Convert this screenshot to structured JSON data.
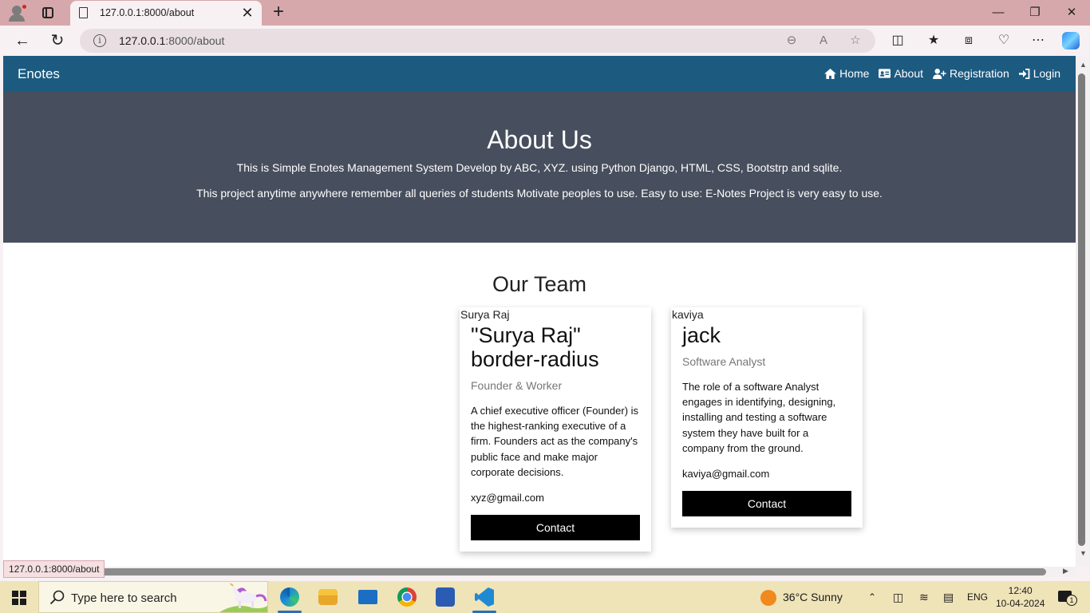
{
  "browser": {
    "tab_title": "127.0.0.1:8000/about",
    "address_host": "127.0.0.1",
    "address_path": ":8000/about",
    "status_url": "127.0.0.1:8000/about",
    "window_controls": {
      "minimize": "—",
      "restore": "❐",
      "close": "✕"
    },
    "icons": [
      "profile-icon",
      "tab-actions-icon",
      "page-icon",
      "close-tab-icon",
      "new-tab-icon",
      "back-icon",
      "refresh-icon",
      "site-info-icon",
      "zoom-out-icon",
      "read-aloud-icon",
      "favorite-star-icon",
      "split-screen-icon",
      "favorites-icon",
      "collections-icon",
      "browser-essentials-icon",
      "more-icon",
      "copilot-icon"
    ]
  },
  "navbar": {
    "brand": "Enotes",
    "links": [
      {
        "label": "Home",
        "icon": "home-icon"
      },
      {
        "label": "About",
        "icon": "id-card-icon"
      },
      {
        "label": "Registration",
        "icon": "user-plus-icon"
      },
      {
        "label": "Login",
        "icon": "sign-in-icon"
      }
    ]
  },
  "hero": {
    "title": "About Us",
    "line1": "This is Simple Enotes Management System Develop by ABC, XYZ. using Python Django, HTML, CSS, Bootstrp and sqlite.",
    "line2": "This project anytime anywhere remember all queries of students Motivate peoples to use. Easy to use: E-Notes Project is very easy to use."
  },
  "team": {
    "title": "Our Team",
    "members": [
      {
        "image_alt": "Surya Raj",
        "name": "\"Surya Raj\" border-radius",
        "role": "Founder & Worker",
        "description": "A chief executive officer (Founder) is the highest-ranking executive of a firm. Founders act as the company's public face and make major corporate decisions.",
        "email": "xyz@gmail.com",
        "button": "Contact"
      },
      {
        "image_alt": "kaviya",
        "name": "jack",
        "role": "Software Analyst",
        "description": "The role of a software Analyst engages in identifying, designing, installing and testing a software system they have built for a company from the ground.",
        "email": "kaviya@gmail.com",
        "button": "Contact"
      }
    ]
  },
  "taskbar": {
    "search_placeholder": "Type here to search",
    "weather": "36°C  Sunny",
    "language": "ENG",
    "time": "12:40",
    "date": "10-04-2024",
    "notification_count": "1",
    "apps": [
      "edge-icon",
      "file-explorer-icon",
      "mail-icon",
      "chrome-icon",
      "word-icon",
      "vscode-icon"
    ]
  },
  "colors": {
    "navbar": "#1d5a80",
    "hero": "#474e5d",
    "button": "#000000",
    "tabbar": "#d7a8ab",
    "taskbar": "#efe3b8"
  }
}
